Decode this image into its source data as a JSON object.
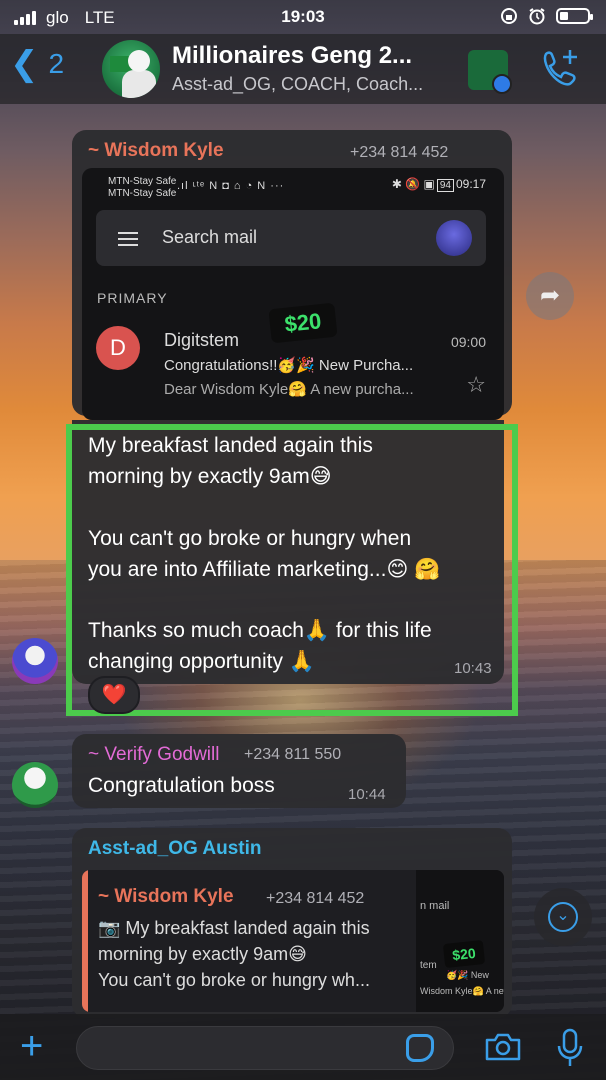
{
  "status_bar": {
    "carrier": "glo",
    "network": "LTE",
    "time": "19:03"
  },
  "header": {
    "back_count": "2",
    "title": "Millionaires Geng 2...",
    "subtitle": "Asst-ad_OG, COACH, Coach..."
  },
  "messages": [
    {
      "sender": "~ Wisdom Kyle",
      "sender_color": "#e8745a",
      "phone": "+234 814 452",
      "screenshot": {
        "status_left_1": "MTN-Stay Safe",
        "status_left_2": "MTN-Stay Safe",
        "status_icons": ".ıl ᶫᵗᵉ N ◘ ⌂ ◔ N ···",
        "status_time": "09:17",
        "battery": "94",
        "search_placeholder": "Search mail",
        "section": "PRIMARY",
        "sender_initial": "D",
        "email_from": "Digitstem",
        "email_line1": "Congratulations!!🥳🎉 New Purcha...",
        "email_line2": "Dear Wisdom Kyle🤗 A new purcha...",
        "email_time": "09:00",
        "price_badge": "$20"
      },
      "lines": [
        "My breakfast landed again this",
        "morning by exactly 9am😅",
        "",
        "You can't go broke or hungry when",
        "you are into Affiliate marketing...😊 🤗",
        "",
        "Thanks so much coach🙏 for this life",
        "changing opportunity 🙏"
      ],
      "time": "10:43",
      "reaction": "❤️"
    },
    {
      "sender": "~ Verify Godwill",
      "sender_color": "#e36bd6",
      "phone": "+234 811 550",
      "text": "Congratulation boss",
      "time": "10:44"
    },
    {
      "sender": "Asst-ad_OG Austin",
      "sender_color": "#3fb8e8",
      "quote": {
        "sender": "~ Wisdom Kyle",
        "phone": "+234 814 452",
        "line1": "My breakfast landed again this",
        "line2": "morning by exactly 9am😅",
        "line3": "You can't go broke or hungry wh...",
        "thumb_mail": "n mail",
        "thumb_from": "tem",
        "thumb_l1": "🥳🎉 New",
        "thumb_l2": "Wisdom Kyle🤗 A new",
        "thumb_price": "$20"
      }
    }
  ],
  "colors": {
    "accent": "#3a9ee8",
    "highlight_border": "#4ccb4c",
    "bubble": "#2c2c30"
  },
  "icons": [
    "signal-icon",
    "alarm-icon",
    "lock-rotation-icon",
    "battery-icon",
    "back-chevron-icon",
    "add-call-icon",
    "forward-icon",
    "scroll-down-icon",
    "plus-icon",
    "sticker-icon",
    "camera-icon",
    "mic-icon"
  ]
}
